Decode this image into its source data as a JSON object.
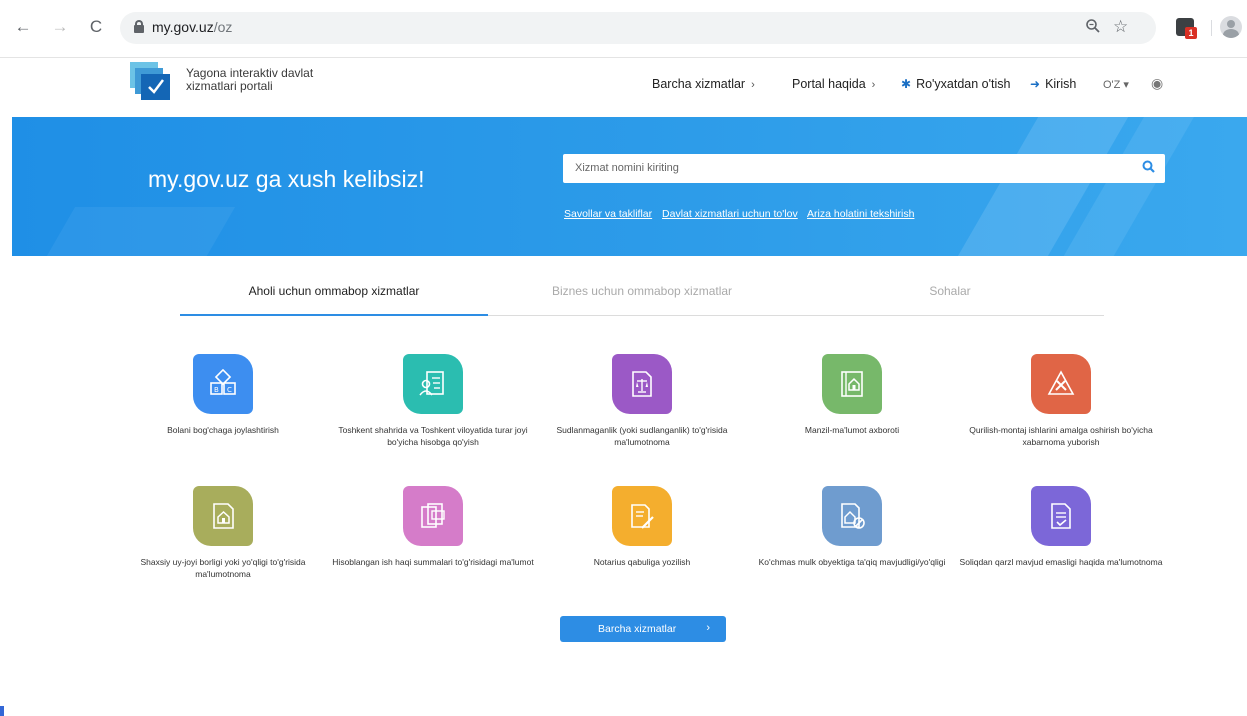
{
  "browser": {
    "url_host": "my.gov.uz",
    "url_path": "/oz",
    "extension_badge": "1"
  },
  "header": {
    "logo_text": "Yagona interaktiv davlat xizmatlari portali",
    "nav": {
      "all_services": "Barcha xizmatlar",
      "about": "Portal haqida",
      "register": "Ro'yxatdan o'tish",
      "login": "Kirish",
      "lang": "O'Z ▾"
    }
  },
  "hero": {
    "title": "my.gov.uz ga xush kelibsiz!",
    "search_placeholder": "Xizmat nomini kiriting",
    "links": [
      "Savollar va takliflar",
      "Davlat xizmatlari uchun to'lov",
      "Ariza holatini tekshirish"
    ]
  },
  "tabs": [
    {
      "label": "Aholi uchun ommabop xizmatlar",
      "active": true
    },
    {
      "label": "Biznes uchun ommabop xizmatlar",
      "active": false
    },
    {
      "label": "Sohalar",
      "active": false
    }
  ],
  "services": [
    {
      "label": "Bolani bog'chaga joylashtirish",
      "color": "#3d8ef0",
      "icon": "abc-blocks-icon"
    },
    {
      "label": "Toshkent shahrida va Toshkent viloyatida turar joyi bo'yicha hisobga qo'yish",
      "color": "#2bbdb0",
      "icon": "registration-card-icon"
    },
    {
      "label": "Sudlanmaganlik (yoki sudlanganlik) to'g'risida ma'lumotnoma",
      "color": "#9b59c6",
      "icon": "justice-document-icon"
    },
    {
      "label": "Manzil-ma'lumot axboroti",
      "color": "#77b86a",
      "icon": "address-book-icon"
    },
    {
      "label": "Qurilish-montaj ishlarini amalga oshirish bo'yicha xabarnoma yuborish",
      "color": "#e06546",
      "icon": "construction-tools-icon"
    },
    {
      "label": "Shaxsiy uy-joyi borligi yoki yo'qligi to'g'risida ma'lumotnoma",
      "color": "#a8ad5c",
      "icon": "house-document-icon"
    },
    {
      "label": "Hisoblangan ish haqi summalari to'g'risidagi ma'lumot",
      "color": "#d57cc9",
      "icon": "salary-documents-icon"
    },
    {
      "label": "Notarius qabuliga yozilish",
      "color": "#f4ae2e",
      "icon": "notary-pen-icon"
    },
    {
      "label": "Ko'chmas mulk obyektiga ta'qiq mavjudligi/yo'qligi",
      "color": "#6f9ccf",
      "icon": "property-ban-icon"
    },
    {
      "label": "Soliqdan qarzl mavjud emasligi haqida ma'lumotnoma",
      "color": "#7c67d8",
      "icon": "tax-document-icon"
    }
  ],
  "all_services_button": "Barcha xizmatlar"
}
